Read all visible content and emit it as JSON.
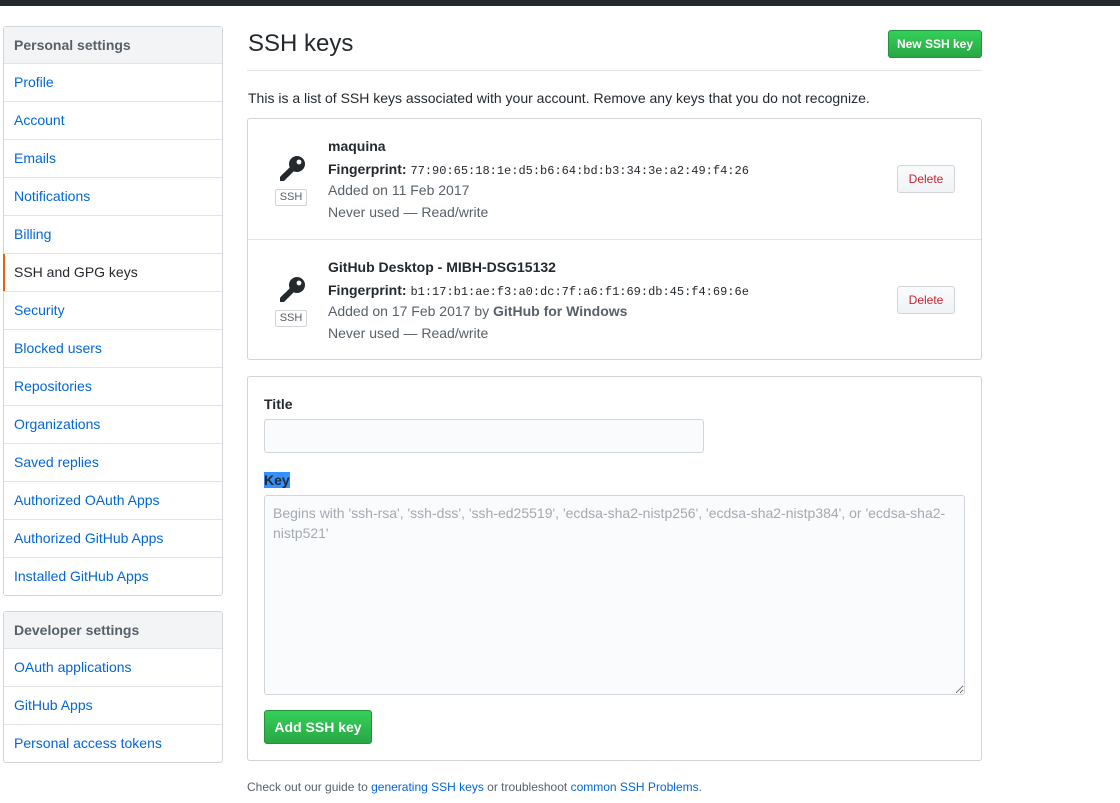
{
  "sidebar": {
    "personal_heading": "Personal settings",
    "personal_items": [
      {
        "label": "Profile"
      },
      {
        "label": "Account"
      },
      {
        "label": "Emails"
      },
      {
        "label": "Notifications"
      },
      {
        "label": "Billing"
      },
      {
        "label": "SSH and GPG keys",
        "selected": true
      },
      {
        "label": "Security"
      },
      {
        "label": "Blocked users"
      },
      {
        "label": "Repositories"
      },
      {
        "label": "Organizations"
      },
      {
        "label": "Saved replies"
      },
      {
        "label": "Authorized OAuth Apps"
      },
      {
        "label": "Authorized GitHub Apps"
      },
      {
        "label": "Installed GitHub Apps"
      }
    ],
    "developer_heading": "Developer settings",
    "developer_items": [
      {
        "label": "OAuth applications"
      },
      {
        "label": "GitHub Apps"
      },
      {
        "label": "Personal access tokens"
      }
    ]
  },
  "main": {
    "title": "SSH keys",
    "new_key_button": "New SSH key",
    "intro": "This is a list of SSH keys associated with your account. Remove any keys that you do not recognize.",
    "keys": [
      {
        "name": "maquina",
        "fingerprint_label": "Fingerprint:",
        "fingerprint": "77:90:65:18:1e:d5:b6:64:bd:b3:34:3e:a2:49:f4:26",
        "added": "Added on 11 Feb 2017",
        "added_by": "",
        "usage": "Never used — Read/write",
        "badge": "SSH",
        "delete_label": "Delete"
      },
      {
        "name": "GitHub Desktop - MIBH-DSG15132",
        "fingerprint_label": "Fingerprint:",
        "fingerprint": "b1:17:b1:ae:f3:a0:dc:7f:a6:f1:69:db:45:f4:69:6e",
        "added": "Added on 17 Feb 2017 by",
        "added_by": "GitHub for Windows",
        "usage": "Never used — Read/write",
        "badge": "SSH",
        "delete_label": "Delete"
      }
    ],
    "form": {
      "title_label": "Title",
      "title_value": "",
      "key_label": "Key",
      "key_placeholder": "Begins with 'ssh-rsa', 'ssh-dss', 'ssh-ed25519', 'ecdsa-sha2-nistp256', 'ecdsa-sha2-nistp384', or 'ecdsa-sha2-nistp521'",
      "submit_label": "Add SSH key"
    },
    "footer": {
      "prefix": "Check out our guide to",
      "link1": "generating SSH keys",
      "middle": "or troubleshoot",
      "link2": "common SSH Problems",
      "suffix": "."
    }
  },
  "colors": {
    "accent_green": "#28a745",
    "link_blue": "#0366d6",
    "danger_red": "#cb2431",
    "selected_marker": "#e36209"
  },
  "icons": {
    "key": "key-icon"
  }
}
